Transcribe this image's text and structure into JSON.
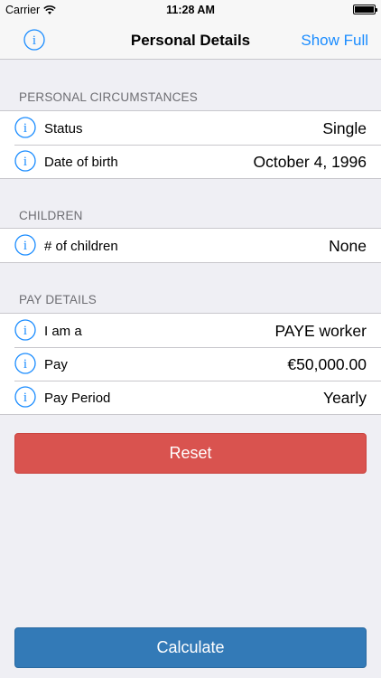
{
  "status_bar": {
    "carrier": "Carrier",
    "time": "11:28 AM"
  },
  "nav": {
    "title": "Personal Details",
    "right_button": "Show Full",
    "info_icon": "info-icon"
  },
  "sections": {
    "personal": {
      "header": "PERSONAL CIRCUMSTANCES",
      "rows": [
        {
          "label": "Status",
          "value": "Single"
        },
        {
          "label": "Date of birth",
          "value": "October 4, 1996"
        }
      ]
    },
    "children": {
      "header": "CHILDREN",
      "rows": [
        {
          "label": "# of children",
          "value": "None"
        }
      ]
    },
    "pay": {
      "header": "PAY DETAILS",
      "rows": [
        {
          "label": "I am a",
          "value": "PAYE worker"
        },
        {
          "label": "Pay",
          "value": "€50,000.00"
        },
        {
          "label": "Pay Period",
          "value": "Yearly"
        }
      ]
    }
  },
  "buttons": {
    "reset": "Reset",
    "calculate": "Calculate"
  },
  "colors": {
    "accent": "#1a8cff",
    "reset": "#d9534f",
    "calculate": "#337ab7",
    "background": "#efeff4"
  }
}
